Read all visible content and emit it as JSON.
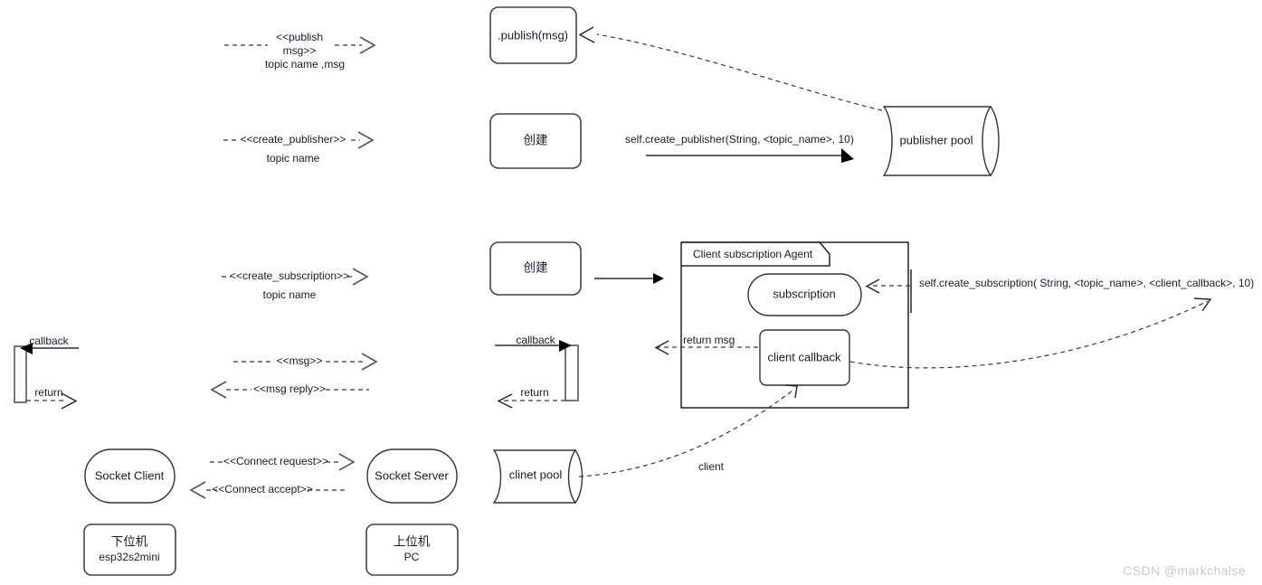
{
  "diagram": {
    "type": "uml-sequence-component-diagram",
    "watermark": "CSDN @markchalse",
    "nodes": [
      {
        "id": "publish_box",
        "label": ".publish(msg)",
        "shape": "rounded-rect"
      },
      {
        "id": "create_pub_box",
        "label": "创建",
        "shape": "rounded-rect"
      },
      {
        "id": "publisher_pool",
        "label": "publisher pool",
        "shape": "horizontal-cylinder"
      },
      {
        "id": "create_sub_box",
        "label": "创建",
        "shape": "rounded-rect"
      },
      {
        "id": "agent_frame",
        "label": "Client subscription Agent",
        "shape": "uml-frame"
      },
      {
        "id": "subscription",
        "label": "subscription",
        "shape": "stadium"
      },
      {
        "id": "client_callback",
        "label": "client callback",
        "shape": "rounded-rect"
      },
      {
        "id": "client_pool",
        "label": "clinet pool",
        "shape": "horizontal-cylinder"
      },
      {
        "id": "socket_client",
        "label": "Socket Client",
        "shape": "stadium"
      },
      {
        "id": "socket_server",
        "label": "Socket Server",
        "shape": "stadium"
      },
      {
        "id": "device_lower",
        "label_line1": "下位机",
        "label_line2": "esp32s2mini",
        "shape": "rounded-rect"
      },
      {
        "id": "device_upper",
        "label_line1": "上位机",
        "label_line2": "PC",
        "shape": "rounded-rect"
      }
    ],
    "messages": {
      "publish_stereotype_line1": "<<publish",
      "publish_stereotype_line2": "msg>>",
      "publish_args": "topic name ,msg",
      "create_publisher_stereotype": "<<create_publisher>>",
      "create_publisher_args": "topic name",
      "create_subscription_stereotype": "<<create_subscription>>",
      "create_subscription_args": "topic name",
      "msg": "<<msg>>",
      "msg_reply": "<<msg reply>>",
      "connect_request": "<<Connect request>>",
      "connect_accept": "<<Connect accept>>"
    },
    "code_calls": {
      "create_publisher": "self.create_publisher(String, <topic_name>, 10)",
      "create_subscription": "self.create_subscription( String, <topic_name>, <client_callback>, 10)"
    },
    "annotations": {
      "callback_left": "callback",
      "return_left": "return",
      "callback_mid": "callback",
      "return_mid": "return",
      "return_msg": "return msg",
      "client_link": "client"
    },
    "colors": {
      "background": "#ffffff",
      "stroke": "#333333",
      "text": "#1a1a2e",
      "dashed": "#555555",
      "watermark": "#c9c9c9"
    }
  }
}
